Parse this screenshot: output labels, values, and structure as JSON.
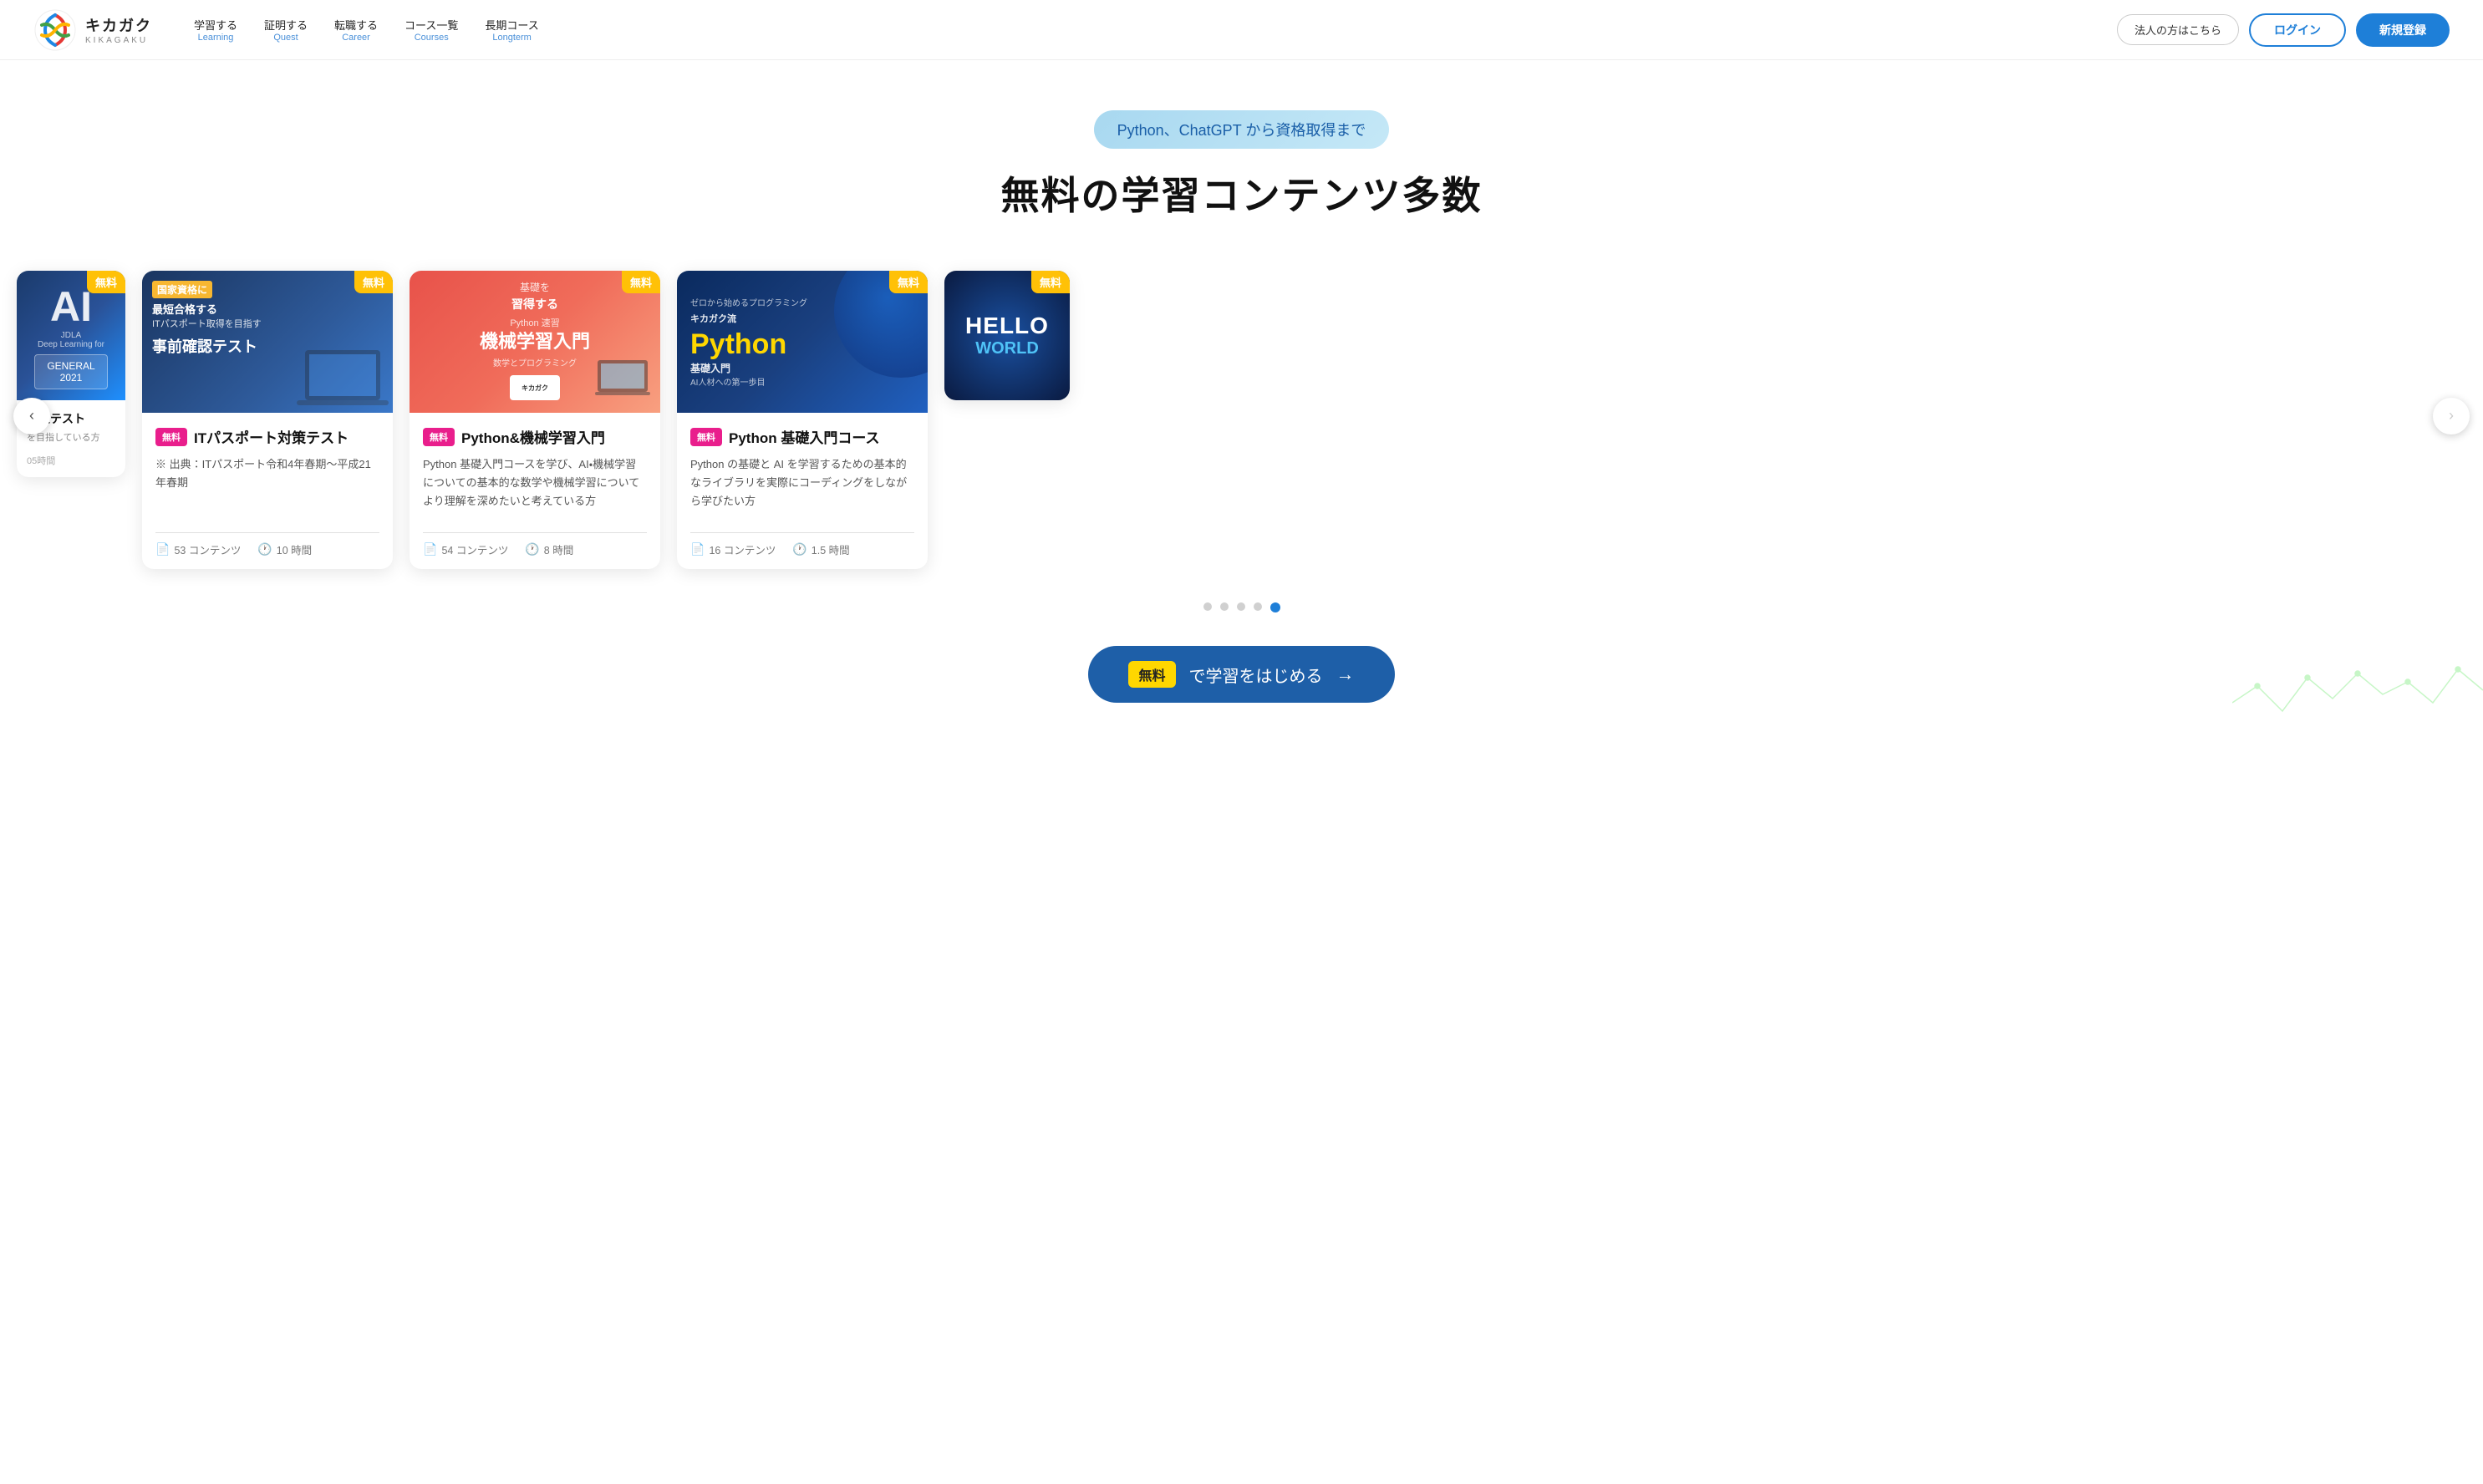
{
  "header": {
    "logo_name": "キカガク",
    "logo_sub": "KIKAGAKU",
    "nav": [
      {
        "ja": "学習する",
        "en": "Learning"
      },
      {
        "ja": "証明する",
        "en": "Quest"
      },
      {
        "ja": "転職する",
        "en": "Career"
      },
      {
        "ja": "コース一覧",
        "en": "Courses"
      },
      {
        "ja": "長期コース",
        "en": "Longterm"
      }
    ],
    "btn_corporate": "法人の方はこちら",
    "btn_login": "ログイン",
    "btn_register": "新規登録"
  },
  "hero": {
    "badge": "Python、ChatGPT から資格取得まで",
    "title": "無料の学習コンテンツ多数"
  },
  "cards": [
    {
      "id": "partial-left",
      "partial": true,
      "side": "left",
      "thumb_type": "thumb-ai",
      "badge_free": "無料",
      "title": "対策テスト",
      "subtitle": "を目指している方",
      "meta_contents": "05時間",
      "partial_label": "AI"
    },
    {
      "id": "it-passport",
      "thumb_type": "thumb-it",
      "badge_free": "無料",
      "tag_free": "無料",
      "title": "ITパスポート対策テスト",
      "desc": "※ 出典：ITパスポート令和4年春期〜平成21年春期",
      "contents_count": "53 コンテンツ",
      "hours": "10 時間",
      "it_line1": "国家資格に",
      "it_line2": "最短合格する",
      "it_line3": "ITパスポート取得を目指す",
      "it_title": "事前確認テスト"
    },
    {
      "id": "python-ml",
      "thumb_type": "thumb-python-ml",
      "badge_free": "無料",
      "tag_free": "無料",
      "title": "Python&機械学習入門",
      "desc": "Python 基礎入門コースを学び、AI・機械学習についての基本的な数学や機械学習についてより理解を深めたいと考えている方",
      "contents_count": "54 コンテンツ",
      "hours": "8 時間",
      "ml_title_line1": "基礎を",
      "ml_title_line2": "習得する",
      "ml_sub1": "Python 速習",
      "ml_sub2": "機械学習入門",
      "ml_sub3": "数学とプログラミング"
    },
    {
      "id": "python-basic",
      "thumb_type": "thumb-python-basic",
      "badge_free": "無料",
      "tag_free": "無料",
      "title": "Python 基礎入門コース",
      "desc": "Python の基礎と AI を学習するための基本的なライブラリを実際にコーディングをしながら学びたい方",
      "contents_count": "16 コンテンツ",
      "hours": "1.5 時間",
      "pb_tag": "ゼロから始めるプログラミング",
      "pb_main": "キカガク流",
      "pb_title": "Python",
      "pb_subtitle": "基礎入門 AI人材への第一歩目"
    },
    {
      "id": "hello-world",
      "partial": true,
      "side": "right",
      "thumb_type": "thumb-hello",
      "badge_free": "無料",
      "hello_text": "HELLO",
      "world_text": "WORLD"
    }
  ],
  "carousel": {
    "dots": 5,
    "active_dot": 4,
    "btn_left": "‹",
    "btn_right": "›"
  },
  "cta": {
    "free_tag": "無料",
    "label": "で学習をはじめる",
    "arrow": "→"
  }
}
